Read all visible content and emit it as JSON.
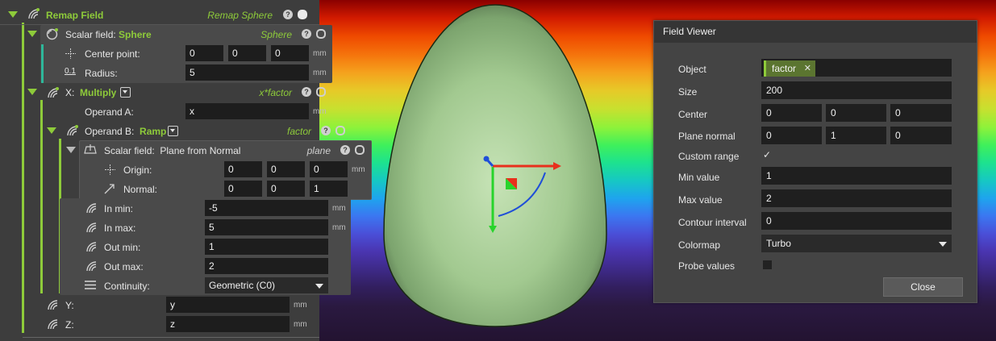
{
  "viewport": {
    "egg_color": "#a4cc92"
  },
  "panel": {
    "root": {
      "title": "Remap Field",
      "expr": "Remap Sphere"
    },
    "sphere": {
      "label": "Scalar field:",
      "type": "Sphere",
      "expr": "Sphere",
      "center_label": "Center point:",
      "center": [
        "0",
        "0",
        "0"
      ],
      "center_unit": "mm",
      "radius_label": "Radius:",
      "radius": "5",
      "radius_unit": "mm"
    },
    "x": {
      "label": "X:",
      "type": "Multiply",
      "expr": "x*factor",
      "operand_a_label": "Operand A:",
      "operand_a": "x",
      "operand_a_unit": "mm",
      "operand_b_label": "Operand B:",
      "operand_b_type": "Ramp",
      "operand_b_expr": "factor"
    },
    "plane": {
      "label": "Scalar field:",
      "type": "Plane from Normal",
      "expr": "plane",
      "origin_label": "Origin:",
      "origin": [
        "0",
        "0",
        "0"
      ],
      "origin_unit": "mm",
      "normal_label": "Normal:",
      "normal": [
        "0",
        "0",
        "1"
      ]
    },
    "ramp": {
      "in_min_label": "In min:",
      "in_min": "-5",
      "in_min_unit": "mm",
      "in_max_label": "In max:",
      "in_max": "5",
      "in_max_unit": "mm",
      "out_min_label": "Out min:",
      "out_min": "1",
      "out_max_label": "Out max:",
      "out_max": "2",
      "continuity_label": "Continuity:",
      "continuity": "Geometric (C0)"
    },
    "y": {
      "label": "Y:",
      "value": "y",
      "unit": "mm"
    },
    "z": {
      "label": "Z:",
      "value": "z",
      "unit": "mm"
    },
    "help_glyph": "?",
    "radius_icon_text": "0.1"
  },
  "dialog": {
    "title": "Field Viewer",
    "object_label": "Object",
    "object_chip": "factor",
    "chip_remove": "✕",
    "size_label": "Size",
    "size": "200",
    "center_label": "Center",
    "center": [
      "0",
      "0",
      "0"
    ],
    "normal_label": "Plane normal",
    "normal": [
      "0",
      "1",
      "0"
    ],
    "custom_range_label": "Custom range",
    "custom_range_checked": "✓",
    "min_label": "Min value",
    "min": "1",
    "max_label": "Max value",
    "max": "2",
    "contour_label": "Contour interval",
    "contour": "0",
    "colormap_label": "Colormap",
    "colormap": "Turbo",
    "probe_label": "Probe values",
    "close": "Close"
  }
}
